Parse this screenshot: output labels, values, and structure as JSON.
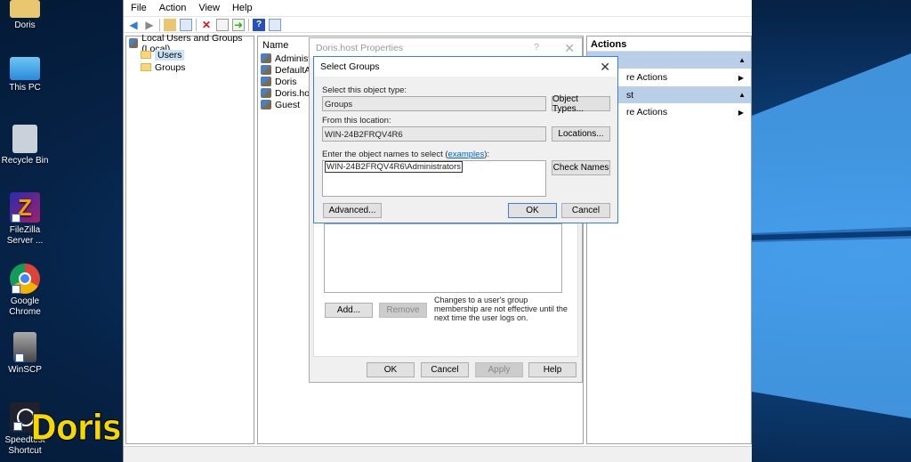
{
  "desktop": {
    "icons": [
      {
        "label": "Doris",
        "icon": "user-folder-icon"
      },
      {
        "label": "This PC",
        "icon": "computer-icon"
      },
      {
        "label": "Recycle Bin",
        "icon": "recycle-bin-icon"
      },
      {
        "label": "FileZilla Server ...",
        "icon": "filezilla-icon"
      },
      {
        "label": "Google Chrome",
        "icon": "chrome-icon"
      },
      {
        "label": "WinSCP",
        "icon": "winscp-icon"
      },
      {
        "label": "Speedtest Shortcut",
        "icon": "speedtest-icon"
      }
    ],
    "brand": "Doris",
    "brand_color": "#f5d800"
  },
  "menu": [
    "File",
    "Action",
    "View",
    "Help"
  ],
  "tree": {
    "root": "Local Users and Groups (Local)",
    "children": [
      "Users",
      "Groups"
    ]
  },
  "list": {
    "header": "Name",
    "items": [
      "Administra",
      "DefaultAcc",
      "Doris",
      "Doris.host",
      "Guest"
    ]
  },
  "actions": {
    "header": "Actions",
    "sections": [
      {
        "title": "",
        "item": "re Actions"
      },
      {
        "title": "st",
        "item": "re Actions"
      }
    ]
  },
  "props": {
    "title": "Doris.host Properties",
    "help": "?",
    "note": "Changes to a user's group membership are not effective until the next time the user logs on.",
    "add": "Add...",
    "remove": "Remove",
    "ok": "OK",
    "cancel": "Cancel",
    "apply": "Apply",
    "help_btn": "Help"
  },
  "select": {
    "title": "Select Groups",
    "type_label": "Select this object type:",
    "type_value": "Groups",
    "object_types": "Object Types...",
    "location_label": "From this location:",
    "location_value": "WIN-24B2FRQV4R6",
    "locations": "Locations...",
    "names_label": "Enter the object names to select (",
    "examples": "examples",
    "names_label_end": "):",
    "names_value": "WIN-24B2FRQV4R6\\Administrators",
    "check_names": "Check Names",
    "advanced": "Advanced...",
    "ok": "OK",
    "cancel": "Cancel"
  }
}
